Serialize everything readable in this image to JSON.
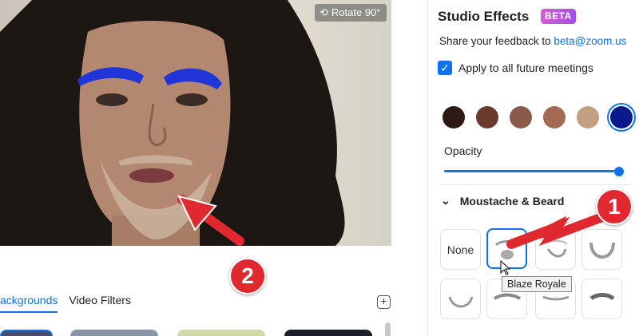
{
  "video": {
    "rotate_label": "Rotate 90°"
  },
  "tabs": [
    {
      "label": "Backgrounds",
      "visible": "ackgrounds",
      "active": true
    },
    {
      "label": "Video Filters",
      "active": false
    }
  ],
  "panel": {
    "title": "Studio Effects",
    "beta": "BETA",
    "feedback_text": "Share your feedback to",
    "feedback_link": "beta@zoom.us",
    "apply_label": "Apply to all future meetings",
    "apply_checked": true,
    "swatches": [
      "#2b1a14",
      "#6a3c2e",
      "#8a5a4a",
      "#a46a56",
      "#c2a07f",
      "#0a1a8c"
    ],
    "selected_swatch": 5,
    "opacity_label": "Opacity",
    "opacity_value": 1.0,
    "section_title": "Moustache & Beard",
    "none_label": "None",
    "tooltip": "Blaze Royale"
  },
  "callouts": [
    "1",
    "2"
  ],
  "colors": {
    "accent": "#0e72ed",
    "callout": "#e0292e"
  }
}
